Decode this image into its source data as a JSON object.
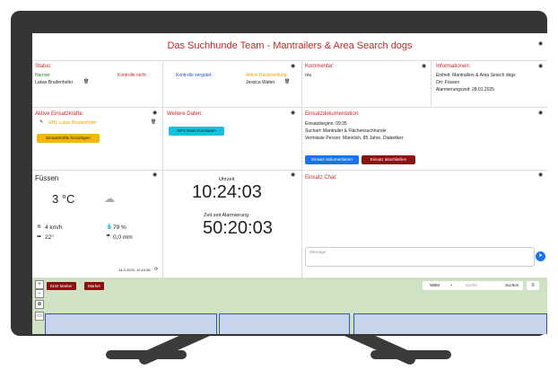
{
  "header": {
    "title": "Das Suchhunde Team - Mantrailers & Area Search dogs"
  },
  "status": {
    "heading": "Status:",
    "col1": "Narrow:",
    "col2": "Kontrolle nicht:",
    "col3": "Kontrolle vergütet:",
    "col4": "Aktive Rückmeldung:",
    "person1": "Lukas Brudenhofer",
    "person2": "Jessica Walter"
  },
  "kommentar": {
    "heading": "Kommentar:",
    "value": "n/a"
  },
  "info": {
    "heading": "Informationen:",
    "line1": "Einheit: Mantrailers & Area Search dogs",
    "line2": "Ort: Füssen",
    "line3": "Alarmierungszeit: 28.01.2025"
  },
  "kraefte": {
    "heading": "Aktive Einsatzkräfte:",
    "item": "RH1 Lukas Brudenhofer",
    "button": "Einsatzkräfte hinzufügen"
  },
  "weitere": {
    "heading": "Weitere Daten:",
    "button": "GPX Datei hochladen"
  },
  "doku": {
    "heading": "Einsatzdokumentation:",
    "line1": "Einsatzbeginn: 09:35",
    "line2": "Suchart: Mantrailer & Flächensuchhunde",
    "line3": "Vermisste Person: Männlich, 85 Jahre, Diabetiker",
    "button1": "Einsatz dokumentieren",
    "button2": "Einsatz abschließen"
  },
  "weather": {
    "city": "Füssen",
    "temp": "3 °C",
    "wind": "4 km/h",
    "humidity": "79 %",
    "direction": "22°",
    "rain": "0,0 mm",
    "updated": "14.3.2025, 10:10:56"
  },
  "clock": {
    "label": "Uhrzeit",
    "time": "10:24:03",
    "since_label": "Zeit seit Alarmierung",
    "since": "50:20:03"
  },
  "chat": {
    "heading": "Einsatz Chat:",
    "placeholder": "Message"
  },
  "map": {
    "button1": "ELW Marker",
    "button2": "Marker",
    "layer": "WBM",
    "search_placeholder": "Suche",
    "search_button": "Suchen"
  }
}
